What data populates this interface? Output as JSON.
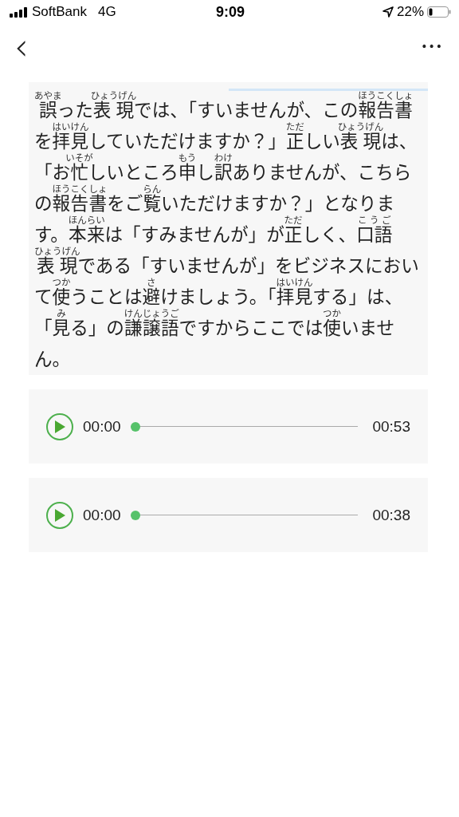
{
  "status_bar": {
    "carrier": "SoftBank",
    "network": "4G",
    "time": "9:09",
    "battery": "22%"
  },
  "nav": {
    "back": "‹",
    "more": "•••"
  },
  "passage": [
    {
      "text": "誤",
      "ruby": "あやま"
    },
    {
      "text": "った"
    },
    {
      "text": "表現",
      "ruby": "ひょうげん"
    },
    {
      "text": "では、「すいませんが、この"
    },
    {
      "text": "報告書",
      "ruby": "ほうこくしょ"
    },
    {
      "text": "を"
    },
    {
      "text": "拝見",
      "ruby": "はいけん"
    },
    {
      "text": "していただけますか？」"
    },
    {
      "text": "正",
      "ruby": "ただ"
    },
    {
      "text": "しい"
    },
    {
      "text": "表現",
      "ruby": "ひょうげん"
    },
    {
      "text": "は、「お"
    },
    {
      "text": "忙",
      "ruby": "いそが"
    },
    {
      "text": "しいところ"
    },
    {
      "text": "申",
      "ruby": "もう"
    },
    {
      "text": "し"
    },
    {
      "text": "訳",
      "ruby": "わけ"
    },
    {
      "text": "ありませんが、こちらの"
    },
    {
      "text": "報告書",
      "ruby": "ほうこくしょ"
    },
    {
      "text": "をご"
    },
    {
      "text": "覧",
      "ruby": "らん"
    },
    {
      "text": "いただけますか？」となります。"
    },
    {
      "text": "本来",
      "ruby": "ほんらい"
    },
    {
      "text": "は「すみませんが」が"
    },
    {
      "text": "正",
      "ruby": "ただ"
    },
    {
      "text": "しく、"
    },
    {
      "text": "口語",
      "ruby": "こうご"
    },
    {
      "text": "表現",
      "ruby": "ひょうげん"
    },
    {
      "text": "である「すいませんが」をビジネスにおいて"
    },
    {
      "text": "使",
      "ruby": "つか"
    },
    {
      "text": "うことは"
    },
    {
      "text": "避",
      "ruby": "さ"
    },
    {
      "text": "けましょう。「"
    },
    {
      "text": "拝見",
      "ruby": "はいけん"
    },
    {
      "text": "する」は、「"
    },
    {
      "text": "見",
      "ruby": "み"
    },
    {
      "text": "る」の"
    },
    {
      "text": "謙譲語",
      "ruby": "けんじょうご"
    },
    {
      "text": "ですからここでは"
    },
    {
      "text": "使",
      "ruby": "つか"
    },
    {
      "text": "いません。"
    }
  ],
  "players": [
    {
      "current": "00:00",
      "duration": "00:53",
      "level": 0
    },
    {
      "current": "00:00",
      "duration": "00:38",
      "level": 0
    }
  ]
}
